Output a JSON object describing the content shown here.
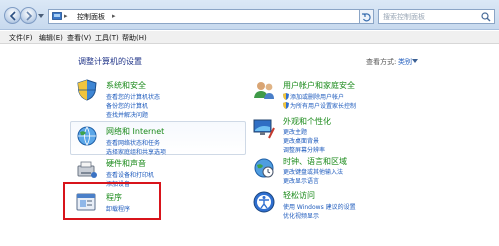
{
  "address": {
    "crumb": "控制面板",
    "separator": "▸",
    "chevron": "▸"
  },
  "search": {
    "placeholder": "搜索控制面板"
  },
  "menu": [
    "文件(F)",
    "编辑(E)",
    "查看(V)",
    "工具(T)",
    "帮助(H)"
  ],
  "main": {
    "title": "调整计算机的设置",
    "view_by_label": "查看方式:",
    "view_by_value": "类别"
  },
  "categories": [
    {
      "title": "系统和安全",
      "icon": "system-security-icon",
      "links": [
        "查看您的计算机状态",
        "备份您的计算机",
        "查找并解决问题"
      ]
    },
    {
      "title": "网络和 Internet",
      "icon": "network-icon",
      "links": [
        "查看网络状态和任务",
        "选择家庭组和共享选项"
      ]
    },
    {
      "title": "硬件和声音",
      "icon": "hardware-sound-icon",
      "links": [
        "查看设备和打印机",
        "添加设备"
      ]
    },
    {
      "title": "程序",
      "icon": "programs-icon",
      "links": [
        "卸载程序"
      ]
    },
    {
      "title": "用户帐户和家庭安全",
      "icon": "user-accounts-icon",
      "links": [
        "添加或删除用户帐户",
        "为所有用户设置家长控制"
      ]
    },
    {
      "title": "外观和个性化",
      "icon": "appearance-icon",
      "links": [
        "更改主题",
        "更改桌面背景",
        "调整屏幕分辨率"
      ]
    },
    {
      "title": "时钟、语言和区域",
      "icon": "clock-language-icon",
      "links": [
        "更改键盘或其他输入法",
        "更改显示语言"
      ]
    },
    {
      "title": "轻松访问",
      "icon": "ease-of-access-icon",
      "links": [
        "使用 Windows 建议的设置",
        "优化视频显示"
      ]
    }
  ],
  "colors": {
    "category_title": "#1a8a1a",
    "link": "#1e5bbd",
    "highlight": "#d8141b"
  }
}
